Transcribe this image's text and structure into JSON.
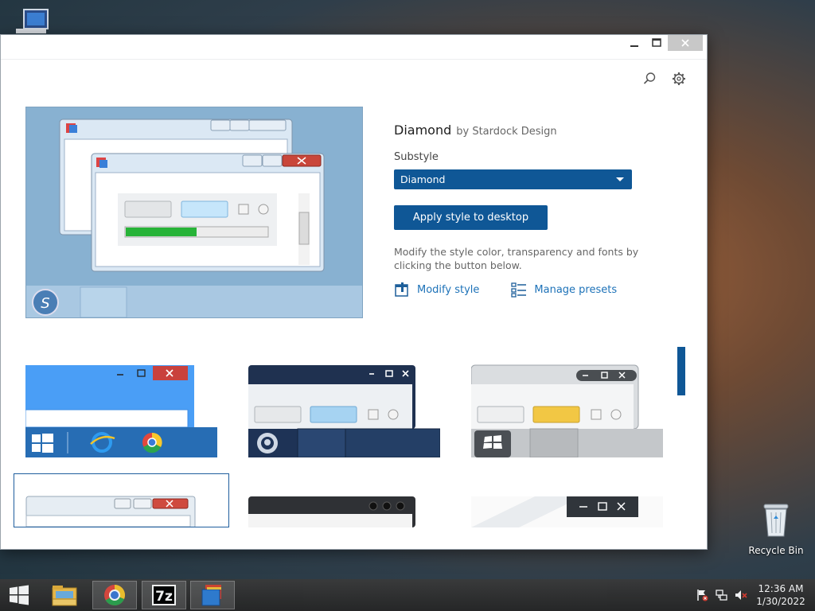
{
  "desktop": {
    "recycle_bin_label": "Recycle Bin"
  },
  "details": {
    "style_name": "Diamond",
    "author": "by Stardock Design",
    "substyle_label": "Substyle",
    "substyle_value": "Diamond",
    "apply_label": "Apply style to desktop",
    "help_text": "Modify the style color, transparency and fonts by clicking the button below.",
    "modify_label": "Modify style",
    "presets_label": "Manage presets"
  },
  "preview": {
    "progress_fraction": 0.5
  },
  "taskbar": {
    "time": "12:36 AM",
    "date": "1/30/2022",
    "apps": [
      "start",
      "file-explorer",
      "chrome",
      "7-zip",
      "windowblinds"
    ]
  },
  "colors": {
    "accent": "#0f5796",
    "link": "#1d72b8"
  }
}
